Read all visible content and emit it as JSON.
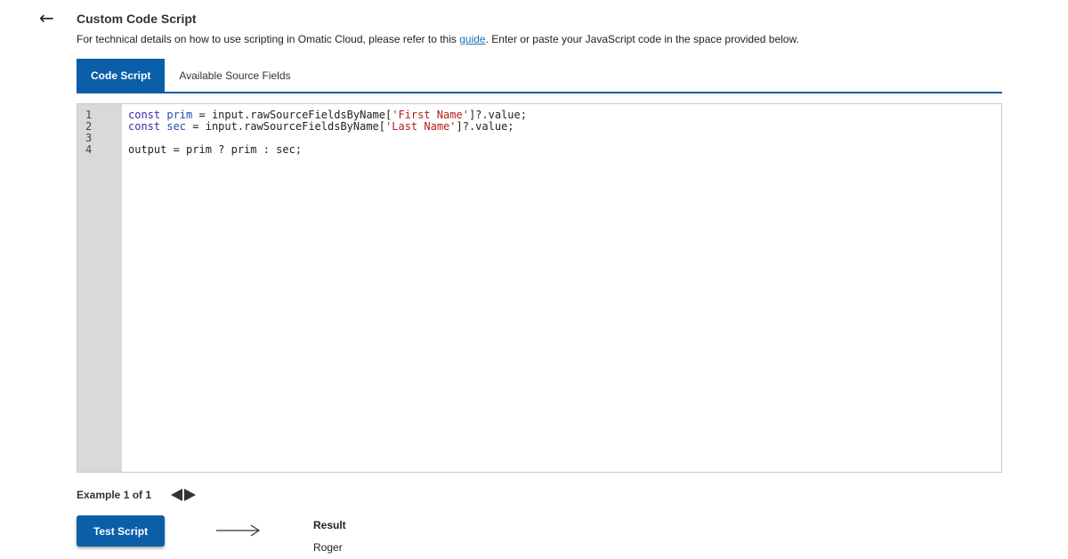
{
  "header": {
    "back_icon": "arrow-left-icon",
    "title": "Custom Code Script",
    "subtitle_before": "For technical details on how to use scripting in Omatic Cloud, please refer to this ",
    "subtitle_link": "guide",
    "subtitle_after": ". Enter or paste your JavaScript code in the space provided below."
  },
  "tabs": [
    {
      "label": "Code Script",
      "active": true
    },
    {
      "label": "Available Source Fields",
      "active": false
    }
  ],
  "editor": {
    "line_numbers": [
      "1",
      "2",
      "3",
      "4"
    ],
    "lines": [
      [
        {
          "t": "const",
          "c": "kw"
        },
        {
          "t": " ",
          "c": ""
        },
        {
          "t": "prim",
          "c": "var"
        },
        {
          "t": " = input.rawSourceFieldsByName[",
          "c": ""
        },
        {
          "t": "'First Name'",
          "c": "str"
        },
        {
          "t": "]?.value;",
          "c": ""
        }
      ],
      [
        {
          "t": "const",
          "c": "kw"
        },
        {
          "t": " ",
          "c": ""
        },
        {
          "t": "sec",
          "c": "var"
        },
        {
          "t": " = input.rawSourceFieldsByName[",
          "c": ""
        },
        {
          "t": "'Last Name'",
          "c": "str"
        },
        {
          "t": "]?.value;",
          "c": ""
        }
      ],
      [],
      [
        {
          "t": "output = prim ? prim : sec;",
          "c": ""
        }
      ]
    ]
  },
  "example": {
    "label": "Example 1 of 1",
    "prev_icon": "triangle-left-icon",
    "next_icon": "triangle-right-icon"
  },
  "test": {
    "button_label": "Test Script",
    "arrow_icon": "long-arrow-right-icon",
    "result_label": "Result",
    "result_value": "Roger"
  },
  "colors": {
    "accent": "#0b5ea8",
    "link": "#1a73b8",
    "gutter": "#d9d9d9",
    "keyword": "#3a2fa8",
    "variable": "#1b4faa",
    "string": "#b0211e"
  }
}
